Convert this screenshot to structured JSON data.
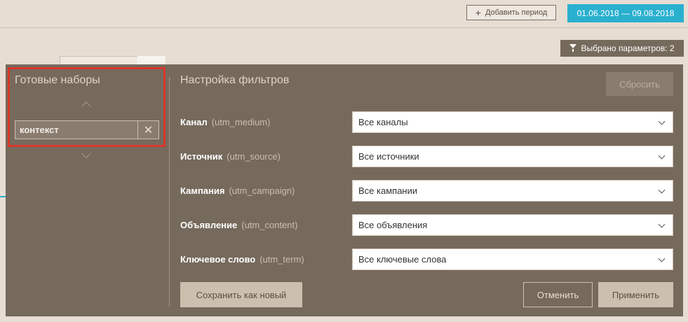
{
  "header": {
    "add_period_label": "Добавить период",
    "date_range": "01.06.2018  —  09.08.2018"
  },
  "params_badge": {
    "label": "Выбрано параметров: 2",
    "icon": "funnel-icon"
  },
  "presets": {
    "title": "Готовые наборы",
    "value": "контекст",
    "clear_icon": "close-icon",
    "highlight_color": "#d9362b"
  },
  "filters": {
    "title": "Настройка фильтров",
    "reset_label": "Сбросить",
    "rows": [
      {
        "label": "Канал",
        "param": "(utm_medium)",
        "value": "Все каналы"
      },
      {
        "label": "Источник",
        "param": "(utm_source)",
        "value": "Все источники"
      },
      {
        "label": "Кампания",
        "param": "(utm_campaign)",
        "value": "Все кампании"
      },
      {
        "label": "Объявление",
        "param": "(utm_content)",
        "value": "Все объявления"
      },
      {
        "label": "Ключевое слово",
        "param": "(utm_term)",
        "value": "Все ключевые слова"
      }
    ],
    "save_label": "Сохранить как новый",
    "cancel_label": "Отменить",
    "apply_label": "Применить"
  },
  "colors": {
    "accent": "#2ab0cf",
    "panel": "#766a5d",
    "background": "#e7ddd3"
  }
}
